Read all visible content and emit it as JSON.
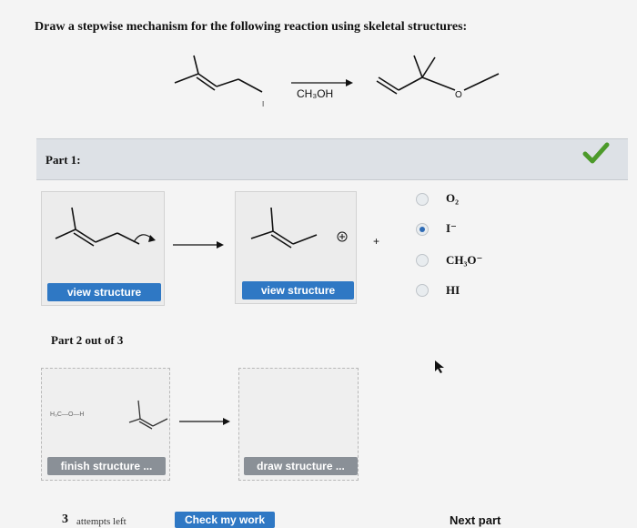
{
  "question": "Draw a stepwise mechanism for the following reaction using skeletal structures:",
  "reagent": "CH₃OH",
  "product_atom_label": "O",
  "part1": {
    "label": "Part 1:",
    "plus": "+",
    "view_structure_1": "view structure",
    "view_structure_2": "view structure",
    "options": [
      {
        "label": "O₂",
        "selected": false
      },
      {
        "label": "I⁻",
        "selected": true
      },
      {
        "label": "CH₃O⁻",
        "selected": false
      },
      {
        "label": "HI",
        "selected": false
      }
    ]
  },
  "part2": {
    "label": "Part 2 out of 3",
    "mini_label": "H₃C—O—H",
    "finish_button": "finish structure ...",
    "draw_button": "draw structure ..."
  },
  "footer": {
    "attempts_count": "3",
    "attempts_text": "attempts left",
    "check_button": "Check my work",
    "next_button": "Next part"
  },
  "colors": {
    "button_blue": "#2f78c4",
    "check_green": "#4c9a2a",
    "bar_gray": "#dde1e6"
  }
}
